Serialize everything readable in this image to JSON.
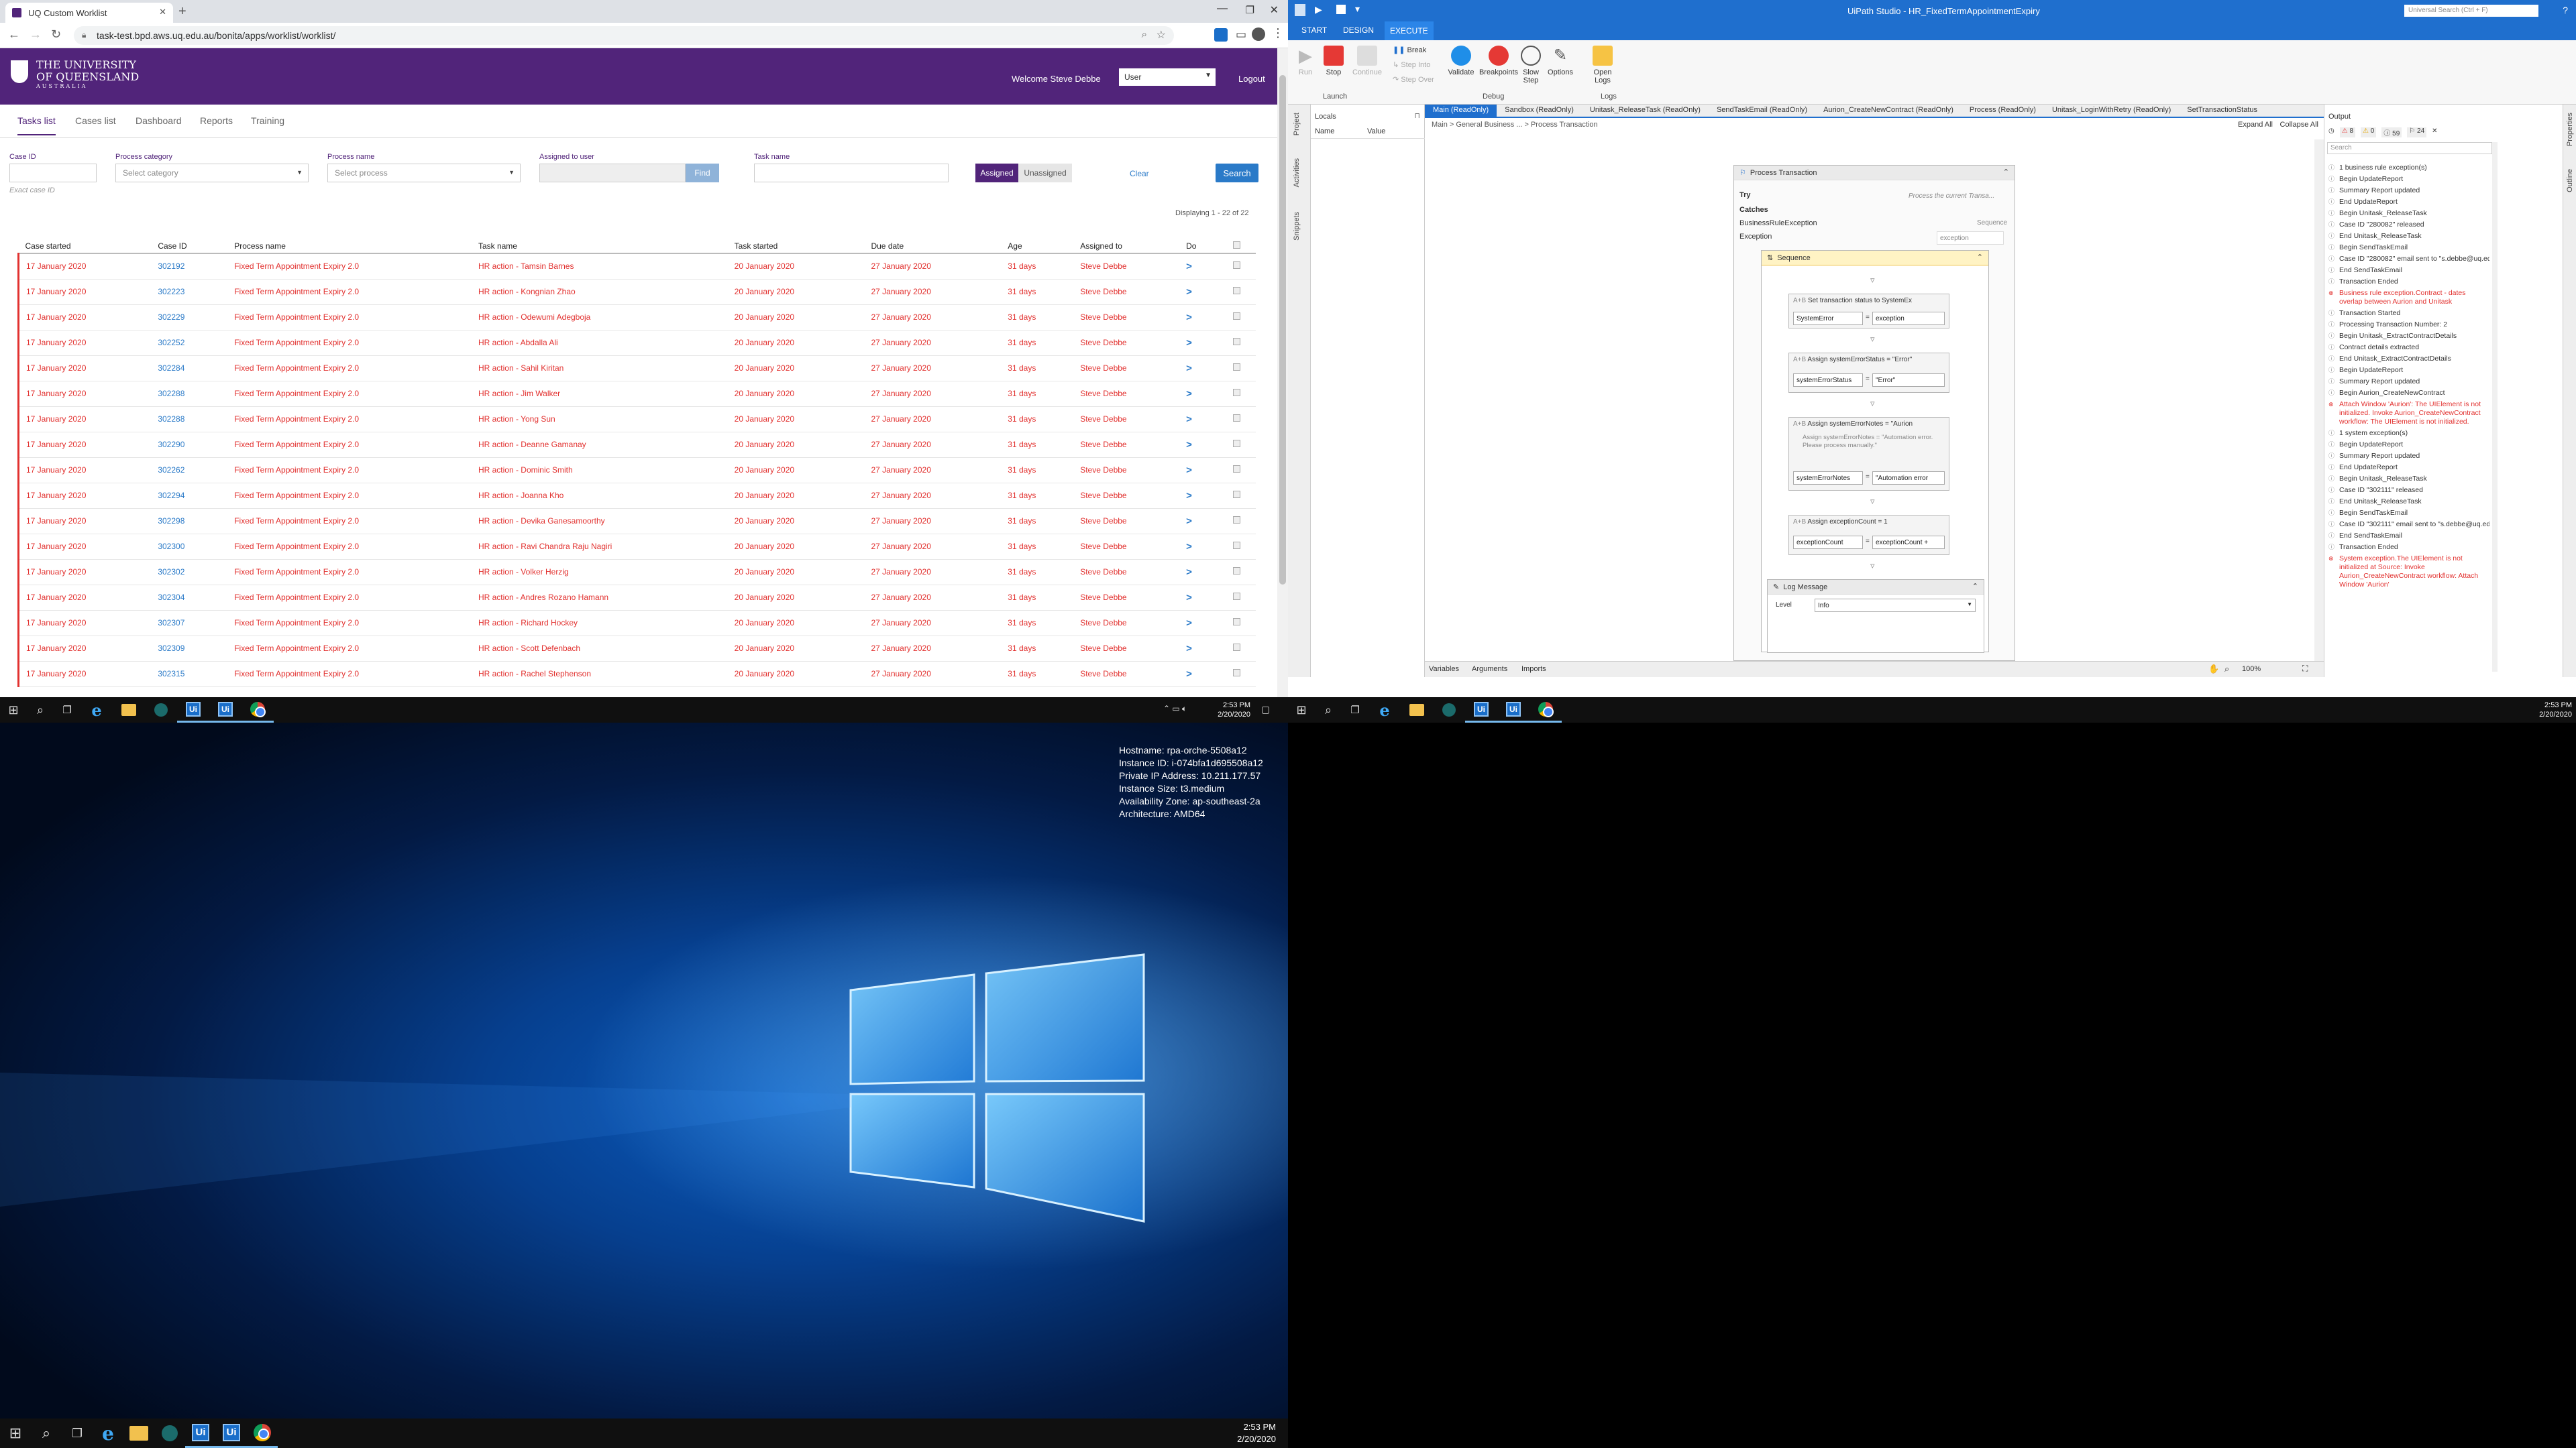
{
  "browser": {
    "tab_title": "UQ Custom Worklist",
    "url": "task-test.bpd.aws.uq.edu.au/bonita/apps/worklist/worklist/",
    "logo_line1": "THE UNIVERSITY",
    "logo_line2": "OF QUEENSLAND",
    "logo_line3": "AUSTRALIA",
    "welcome": "Welcome Steve Debbe",
    "role_select": "User",
    "logout": "Logout",
    "nav": [
      "Tasks list",
      "Cases list",
      "Dashboard",
      "Reports",
      "Training"
    ],
    "filters": {
      "case_id_label": "Case ID",
      "case_id_hint": "Exact case ID",
      "category_label": "Process category",
      "category_placeholder": "Select category",
      "process_label": "Process name",
      "process_placeholder": "Select process",
      "assigned_label": "Assigned to user",
      "find": "Find",
      "task_label": "Task name",
      "assigned_btn": "Assigned",
      "unassigned_btn": "Unassigned",
      "clear": "Clear",
      "search": "Search"
    },
    "displaying": "Displaying 1 - 22 of 22",
    "columns": [
      "Case started",
      "Case ID",
      "Process name",
      "Task name",
      "Task started",
      "Due date",
      "Age",
      "Assigned to",
      "Do"
    ],
    "rows": [
      [
        "17 January 2020",
        "302192",
        "Fixed Term Appointment Expiry 2.0",
        "HR action - Tamsin Barnes",
        "20 January 2020",
        "27 January 2020",
        "31 days",
        "Steve Debbe"
      ],
      [
        "17 January 2020",
        "302223",
        "Fixed Term Appointment Expiry 2.0",
        "HR action - Kongnian Zhao",
        "20 January 2020",
        "27 January 2020",
        "31 days",
        "Steve Debbe"
      ],
      [
        "17 January 2020",
        "302229",
        "Fixed Term Appointment Expiry 2.0",
        "HR action - Odewumi Adegboja",
        "20 January 2020",
        "27 January 2020",
        "31 days",
        "Steve Debbe"
      ],
      [
        "17 January 2020",
        "302252",
        "Fixed Term Appointment Expiry 2.0",
        "HR action - Abdalla Ali",
        "20 January 2020",
        "27 January 2020",
        "31 days",
        "Steve Debbe"
      ],
      [
        "17 January 2020",
        "302284",
        "Fixed Term Appointment Expiry 2.0",
        "HR action - Sahil Kiritan",
        "20 January 2020",
        "27 January 2020",
        "31 days",
        "Steve Debbe"
      ],
      [
        "17 January 2020",
        "302288",
        "Fixed Term Appointment Expiry 2.0",
        "HR action - Jim Walker",
        "20 January 2020",
        "27 January 2020",
        "31 days",
        "Steve Debbe"
      ],
      [
        "17 January 2020",
        "302288",
        "Fixed Term Appointment Expiry 2.0",
        "HR action - Yong Sun",
        "20 January 2020",
        "27 January 2020",
        "31 days",
        "Steve Debbe"
      ],
      [
        "17 January 2020",
        "302290",
        "Fixed Term Appointment Expiry 2.0",
        "HR action - Deanne Gamanay",
        "20 January 2020",
        "27 January 2020",
        "31 days",
        "Steve Debbe"
      ],
      [
        "17 January 2020",
        "302262",
        "Fixed Term Appointment Expiry 2.0",
        "HR action - Dominic Smith",
        "20 January 2020",
        "27 January 2020",
        "31 days",
        "Steve Debbe"
      ],
      [
        "17 January 2020",
        "302294",
        "Fixed Term Appointment Expiry 2.0",
        "HR action - Joanna Kho",
        "20 January 2020",
        "27 January 2020",
        "31 days",
        "Steve Debbe"
      ],
      [
        "17 January 2020",
        "302298",
        "Fixed Term Appointment Expiry 2.0",
        "HR action - Devika Ganesamoorthy",
        "20 January 2020",
        "27 January 2020",
        "31 days",
        "Steve Debbe"
      ],
      [
        "17 January 2020",
        "302300",
        "Fixed Term Appointment Expiry 2.0",
        "HR action - Ravi Chandra Raju Nagiri",
        "20 January 2020",
        "27 January 2020",
        "31 days",
        "Steve Debbe"
      ],
      [
        "17 January 2020",
        "302302",
        "Fixed Term Appointment Expiry 2.0",
        "HR action - Volker Herzig",
        "20 January 2020",
        "27 January 2020",
        "31 days",
        "Steve Debbe"
      ],
      [
        "17 January 2020",
        "302304",
        "Fixed Term Appointment Expiry 2.0",
        "HR action - Andres Rozano Hamann",
        "20 January 2020",
        "27 January 2020",
        "31 days",
        "Steve Debbe"
      ],
      [
        "17 January 2020",
        "302307",
        "Fixed Term Appointment Expiry 2.0",
        "HR action - Richard Hockey",
        "20 January 2020",
        "27 January 2020",
        "31 days",
        "Steve Debbe"
      ],
      [
        "17 January 2020",
        "302309",
        "Fixed Term Appointment Expiry 2.0",
        "HR action - Scott Defenbach",
        "20 January 2020",
        "27 January 2020",
        "31 days",
        "Steve Debbe"
      ],
      [
        "17 January 2020",
        "302315",
        "Fixed Term Appointment Expiry 2.0",
        "HR action - Rachel Stephenson",
        "20 January 2020",
        "27 January 2020",
        "31 days",
        "Steve Debbe"
      ]
    ]
  },
  "studio": {
    "title": "UiPath Studio - HR_FixedTermAppointmentExpiry",
    "search_placeholder": "Universal Search (Ctrl + F)",
    "ribbon_tabs": [
      "START",
      "DESIGN",
      "EXECUTE"
    ],
    "ribbon_buttons": [
      "Run",
      "Stop",
      "Continue",
      "Break",
      "Step Into",
      "Step Over",
      "Validate",
      "Breakpoints",
      "Slow Step",
      "Options",
      "Open Logs"
    ],
    "ribbon_groups": [
      "Launch",
      "Debug",
      "Logs"
    ],
    "left_tabs": [
      "Project",
      "Activities",
      "Snippets"
    ],
    "locals_title": "Locals",
    "locals_cols": [
      "Name",
      "Value"
    ],
    "doc_tabs": [
      "Main (ReadOnly)",
      "Sandbox (ReadOnly)",
      "Unitask_ReleaseTask (ReadOnly)",
      "SendTaskEmail (ReadOnly)",
      "Aurion_CreateNewContract (ReadOnly)",
      "Process (ReadOnly)",
      "Unitask_LoginWithRetry (ReadOnly)",
      "SetTransactionStatus"
    ],
    "breadcrumb": "Main  >  General Business ...  >  Process Transaction",
    "expand_all": "Expand All",
    "collapse_all": "Collapse All",
    "workflow": {
      "container": "Process Transaction",
      "try_label": "Try",
      "try_hint": "Process the current Transa...",
      "catches_label": "Catches",
      "catch_type": "BusinessRuleException",
      "catch_action": "Sequence",
      "exception_label": "Exception",
      "exception_value": "exception",
      "sequence": "Sequence",
      "set_status": "Set transaction status to SystemEx",
      "set_status_left": "SystemError",
      "set_status_right": "exception",
      "assign1": "Assign systemErrorStatus = \"Error\"",
      "assign1_left": "systemErrorStatus",
      "assign1_right": "\"Error\"",
      "assign2": "Assign systemErrorNotes = \"Aurion",
      "assign2_note": "Assign systemErrorNotes = \"Automation error. Please process manually.\"",
      "assign2_left": "systemErrorNotes",
      "assign2_right": "\"Automation error",
      "assign3": "Assign exceptionCount = 1",
      "assign3_left": "exceptionCount",
      "assign3_right": "exceptionCount +",
      "log": "Log Message",
      "level_label": "Level",
      "level_value": "Info"
    },
    "bottom_tabs": [
      "Variables",
      "Arguments",
      "Imports"
    ],
    "zoom": "100%",
    "output_title": "Output",
    "output_counts": [
      "8",
      "0",
      "59",
      "24"
    ],
    "output_search": "Search",
    "output": [
      {
        "t": "1 business rule exception(s)",
        "e": false
      },
      {
        "t": "Begin UpdateReport",
        "e": false
      },
      {
        "t": "Summary Report updated",
        "e": false
      },
      {
        "t": "End UpdateReport",
        "e": false
      },
      {
        "t": "Begin Unitask_ReleaseTask",
        "e": false
      },
      {
        "t": "Case ID \"280082\" released",
        "e": false
      },
      {
        "t": "End Unitask_ReleaseTask",
        "e": false
      },
      {
        "t": "Begin SendTaskEmail",
        "e": false
      },
      {
        "t": "Case ID \"280082\" email sent to \"s.debbe@uq.edu.au\"",
        "e": false
      },
      {
        "t": "End SendTaskEmail",
        "e": false
      },
      {
        "t": "Transaction Ended",
        "e": false
      },
      {
        "t": "Business rule exception.Contract - dates overlap between Aurion and Unitask",
        "e": true
      },
      {
        "t": "Transaction Started",
        "e": false
      },
      {
        "t": "Processing Transaction Number: 2",
        "e": false
      },
      {
        "t": "Begin Unitask_ExtractContractDetails",
        "e": false
      },
      {
        "t": "Contract details extracted",
        "e": false
      },
      {
        "t": "End Unitask_ExtractContractDetails",
        "e": false
      },
      {
        "t": "Begin UpdateReport",
        "e": false
      },
      {
        "t": "Summary Report updated",
        "e": false
      },
      {
        "t": "Begin Aurion_CreateNewContract",
        "e": false
      },
      {
        "t": "Attach Window 'Aurion': The UIElement is not initialized. Invoke Aurion_CreateNewContract workflow: The UIElement is not initialized.",
        "e": true
      },
      {
        "t": "1 system exception(s)",
        "e": false
      },
      {
        "t": "Begin UpdateReport",
        "e": false
      },
      {
        "t": "Summary Report updated",
        "e": false
      },
      {
        "t": "End UpdateReport",
        "e": false
      },
      {
        "t": "Begin Unitask_ReleaseTask",
        "e": false
      },
      {
        "t": "Case ID \"302111\" released",
        "e": false
      },
      {
        "t": "End Unitask_ReleaseTask",
        "e": false
      },
      {
        "t": "Begin SendTaskEmail",
        "e": false
      },
      {
        "t": "Case ID \"302111\" email sent to \"s.debbe@uq.edu.au\"",
        "e": false
      },
      {
        "t": "End SendTaskEmail",
        "e": false
      },
      {
        "t": "Transaction Ended",
        "e": false
      },
      {
        "t": "System exception.The UIElement is not initialized at Source: Invoke Aurion_CreateNewContract workflow: Attach Window 'Aurion'",
        "e": true
      }
    ],
    "right_tabs": [
      "Properties",
      "Outline"
    ]
  },
  "desktop": {
    "info": [
      "Hostname: rpa-orche-5508a12",
      "Instance ID: i-074bfa1d695508a12",
      "Private IP Address: 10.211.177.57",
      "Instance Size: t3.medium",
      "Availability Zone: ap-southeast-2a",
      "Architecture: AMD64"
    ]
  },
  "clock": {
    "time": "2:53 PM",
    "date": "2/20/2020"
  }
}
